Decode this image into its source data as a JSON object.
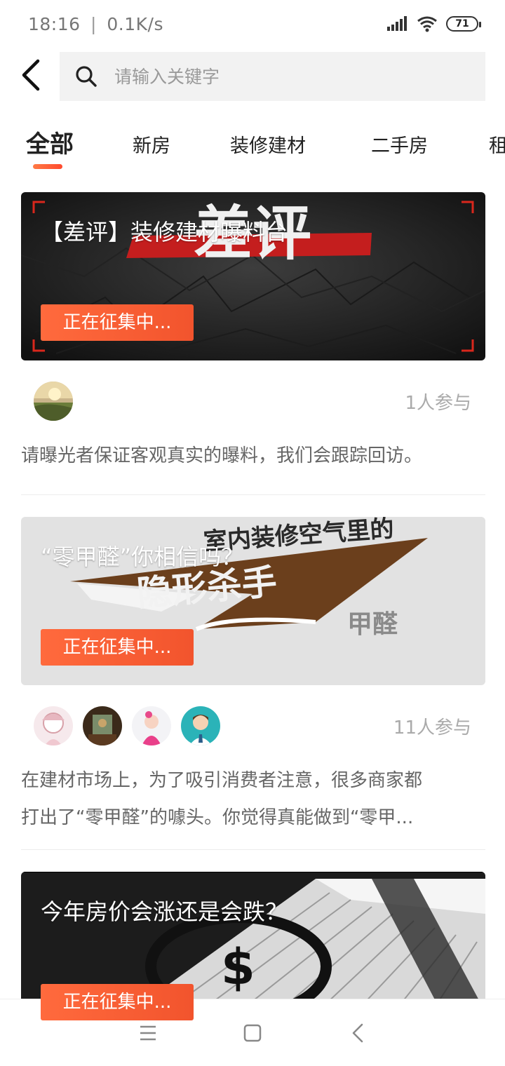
{
  "status_bar": {
    "time": "18:16",
    "separator": "|",
    "speed": "0.1K/s",
    "battery": "71",
    "icons": [
      "signal-icon",
      "wifi-icon",
      "battery-icon"
    ]
  },
  "header": {
    "back_icon": "back-arrow-icon",
    "search_icon": "search-icon",
    "search_placeholder": "请输入关键字"
  },
  "tabs": [
    {
      "label": "全部",
      "active": true
    },
    {
      "label": "新房",
      "active": false
    },
    {
      "label": "装修建材",
      "active": false
    },
    {
      "label": "二手房",
      "active": false
    },
    {
      "label": "租",
      "active": false
    }
  ],
  "colors": {
    "accent": "#f2542d",
    "accent_light": "#ff7a45",
    "muted_text": "#aaaaaa",
    "body_text": "#666666"
  },
  "cards": [
    {
      "title": "【差评】装修建材曝料台",
      "button": "正在征集中...",
      "participants": "1人参与",
      "description": "请曝光者保证客观真实的曝料，我们会跟踪回访。",
      "banner_art_text": "差评"
    },
    {
      "title": "“零甲醛”你相信吗？",
      "button": "正在征集中...",
      "participants": "11人参与",
      "description_line1": "在建材市场上，为了吸引消费者注意，很多商家都",
      "description_line2": "打出了“零甲醛”的噱头。你觉得真能做到“零甲...",
      "banner_art_text_1": "室内装修空气里的",
      "banner_art_text_2": "隐形杀手",
      "banner_art_text_3": "甲醛"
    },
    {
      "title": "今年房价会涨还是会跌？",
      "button": "正在征集中..."
    }
  ],
  "nav_bar": {
    "icons": [
      "menu-icon",
      "home-icon",
      "back-icon"
    ]
  }
}
